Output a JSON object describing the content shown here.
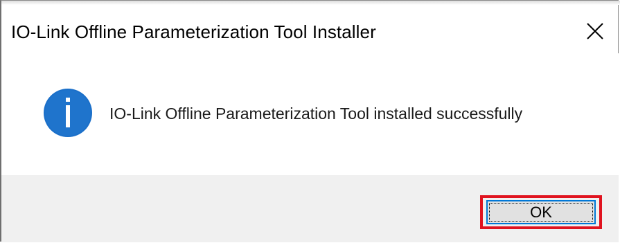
{
  "window": {
    "title": "IO-Link Offline Parameterization Tool Installer",
    "close_icon": "close-icon"
  },
  "content": {
    "icon": "info-icon",
    "message": "IO-Link Offline Parameterization Tool installed successfully"
  },
  "footer": {
    "ok_label": "OK",
    "highlight_color": "#e0131f"
  },
  "colors": {
    "info_icon_blue": "#1a6fc9",
    "button_focus_border": "#0078d7",
    "footer_background": "#f0f0f0"
  }
}
